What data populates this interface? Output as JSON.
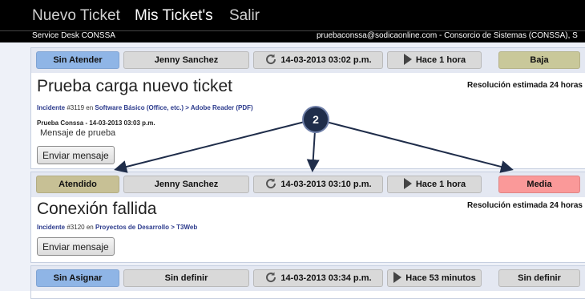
{
  "nav": {
    "items": [
      {
        "label": "Nuevo Ticket",
        "active": false
      },
      {
        "label": "Mis Ticket's",
        "active": true
      },
      {
        "label": "Salir",
        "active": false
      }
    ]
  },
  "subbar": {
    "left": "Service Desk CONSSA",
    "right": "pruebaconssa@sodicaonline.com - Consorcio de Sistemas (CONSSA), S"
  },
  "tickets": [
    {
      "status": "Sin Atender",
      "assignee": "Jenny Sanchez",
      "date": "14-03-2013 03:02 p.m.",
      "elapsed": "Hace 1 hora",
      "priority": "Baja",
      "title": "Prueba carga nuevo ticket",
      "estimate": "Resolución estimada 24 horas",
      "incident_label": "Incidente",
      "incident_number": "#3119",
      "incident_en": "en",
      "category": "Software Básico (Office, etc.) > Adobe Reader (PDF)",
      "message_header": "Prueba Conssa - 14-03-2013 03:03 p.m.",
      "message_body": "Mensaje de prueba",
      "button": "Enviar mensaje"
    },
    {
      "status": "Atendido",
      "assignee": "Jenny Sanchez",
      "date": "14-03-2013 03:10 p.m.",
      "elapsed": "Hace 1 hora",
      "priority": "Media",
      "title": "Conexión fallida",
      "estimate": "Resolución estimada 24 horas",
      "incident_label": "Incidente",
      "incident_number": "#3120",
      "incident_en": "en",
      "category": "Proyectos de Desarrollo > T3Web",
      "button": "Enviar mensaje"
    },
    {
      "status": "Sin Asignar",
      "assignee": "Sin definir",
      "date": "14-03-2013 03:34 p.m.",
      "elapsed": "Hace 53 minutos",
      "priority": "Sin definir"
    }
  ],
  "callout": {
    "number": "2"
  },
  "colors": {
    "status_unattended": "#8fb5e6",
    "status_attended": "#c7c095",
    "priority_low": "#c9c89a",
    "priority_medium": "#fa9999",
    "neutral_pill": "#d9d9d9",
    "callout_bg": "#1f2d4a"
  }
}
